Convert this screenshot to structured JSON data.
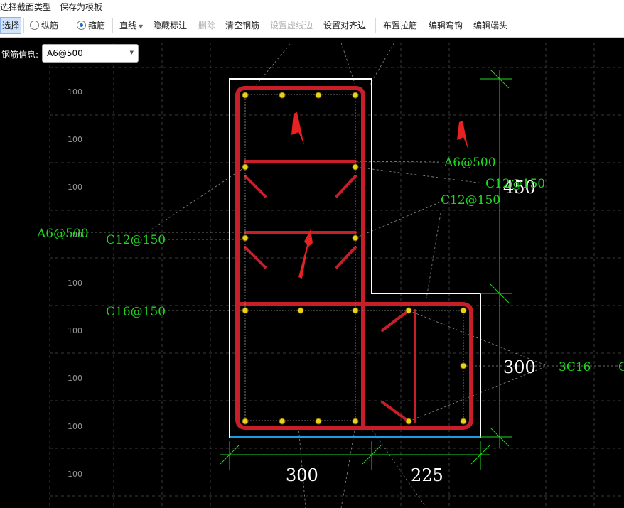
{
  "menu": {
    "items": [
      "选择截面类型",
      "保存为模板"
    ]
  },
  "toolbar": {
    "select": "选择",
    "longitudinal": "纵筋",
    "stirrup": "箍筋",
    "line": "直线",
    "hide_annotation": "隐藏标注",
    "delete": "删除",
    "clear_rebar": "清空钢筋",
    "set_virtual_edge": "设置虚线边",
    "set_align_edge": "设置对齐边",
    "place_tie": "布置拉筋",
    "edit_hook": "编辑弯钩",
    "edit_end": "编辑端头"
  },
  "rebar_info": {
    "label": "钢筋信息:",
    "value": "A6@500"
  },
  "drawing": {
    "grid_labels": [
      "100",
      "100",
      "100",
      "100",
      "100",
      "100",
      "100",
      "100",
      "100"
    ],
    "annotations": {
      "a6_right": "A6@500",
      "c12_150_top": "C12@150",
      "c12_150_mid": "C12@150",
      "a6_left": "A6@500",
      "c12_150_left": "C12@150",
      "c16_150": "C16@150",
      "bars_3c16": "3C16",
      "cut_edge": "C"
    },
    "dimensions": {
      "height_top": "450",
      "height_bottom": "300",
      "width_left": "300",
      "width_right": "225"
    },
    "colors": {
      "rebar": "#c81e2a",
      "annotation": "#1fd81f",
      "outline": "#ffffff",
      "bar_dot": "#e8d21a",
      "baseline": "#1e9be0"
    }
  }
}
